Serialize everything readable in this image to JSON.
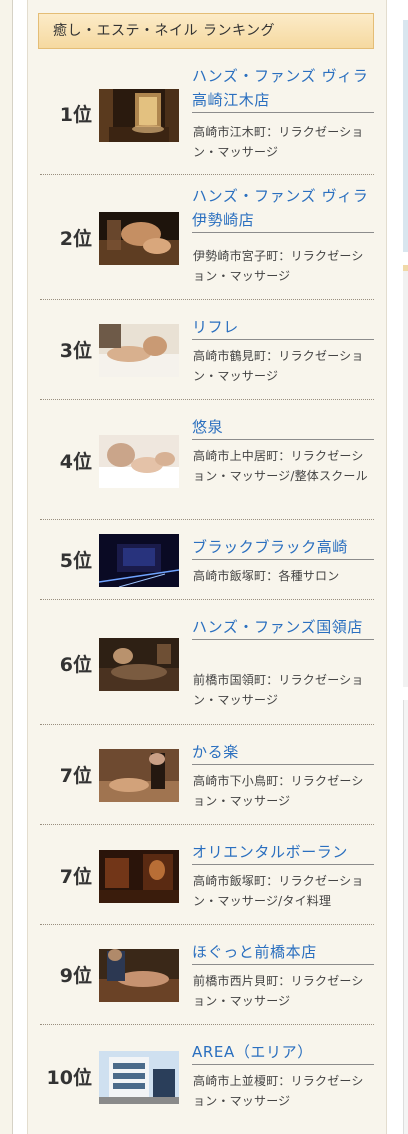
{
  "ranking": {
    "title": "癒し・エステ・ネイル ランキング",
    "items": [
      {
        "rank": "1位",
        "name": "ハンズ・ファンズ ヴィラ 高崎江木店",
        "desc": "高崎市江木町：リラクゼーション・マッサージ",
        "icon": "spa-room-photo"
      },
      {
        "rank": "2位",
        "name": "ハンズ・ファンズ ヴィラ伊勢崎店",
        "desc": "伊勢崎市宮子町：リラクゼーション・マッサージ",
        "icon": "massage-photo"
      },
      {
        "rank": "3位",
        "name": "リフレ",
        "desc": "高崎市鶴見町：リラクゼーション・マッサージ",
        "icon": "foot-massage-photo"
      },
      {
        "rank": "4位",
        "name": "悠泉",
        "desc": "高崎市上中居町：リラクゼーション・マッサージ/整体スクール",
        "icon": "foot-care-photo"
      },
      {
        "rank": "5位",
        "name": "ブラックブラック高崎",
        "desc": "高崎市飯塚町：各種サロン",
        "icon": "salon-exterior-photo"
      },
      {
        "rank": "6位",
        "name": "ハンズ・ファンズ国領店",
        "desc": "前橋市国領町：リラクゼーション・マッサージ",
        "icon": "relax-room-photo"
      },
      {
        "rank": "7位",
        "name": "かる楽",
        "desc": "高崎市下小鳥町：リラクゼーション・マッサージ",
        "icon": "body-care-photo"
      },
      {
        "rank": "7位",
        "name": "オリエンタルボーラン",
        "desc": "高崎市飯塚町：リラクゼーション・マッサージ/タイ料理",
        "icon": "thai-interior-photo"
      },
      {
        "rank": "9位",
        "name": "ほぐっと前橋本店",
        "desc": "前橋市西片貝町：リラクゼーション・マッサージ",
        "icon": "back-massage-photo"
      },
      {
        "rank": "10位",
        "name": "AREA（エリア）",
        "desc": "高崎市上並榎町：リラクゼーション・マッサージ",
        "icon": "building-photo"
      }
    ]
  }
}
